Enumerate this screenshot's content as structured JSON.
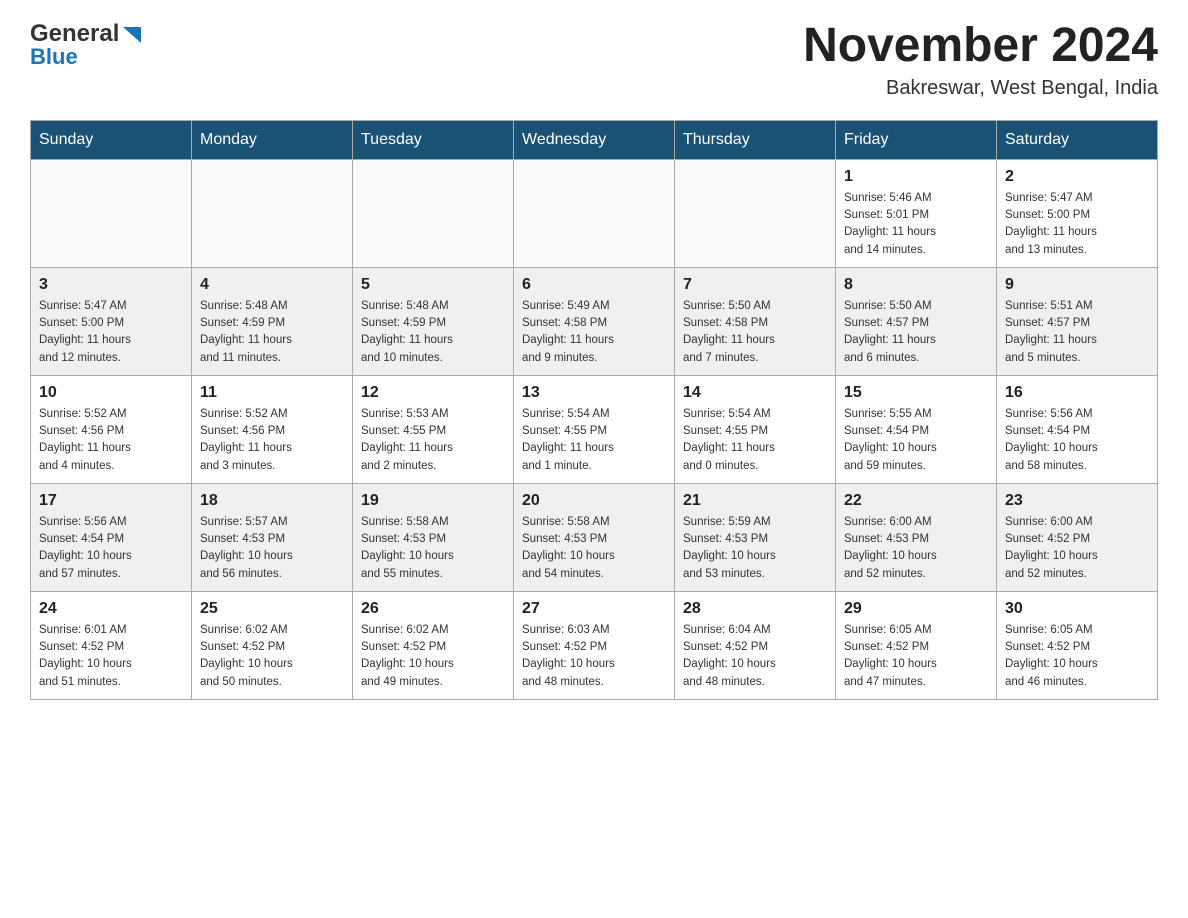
{
  "header": {
    "logo_general": "General",
    "logo_blue": "Blue",
    "month_title": "November 2024",
    "location": "Bakreswar, West Bengal, India"
  },
  "days_of_week": [
    "Sunday",
    "Monday",
    "Tuesday",
    "Wednesday",
    "Thursday",
    "Friday",
    "Saturday"
  ],
  "weeks": [
    {
      "days": [
        {
          "number": "",
          "info": ""
        },
        {
          "number": "",
          "info": ""
        },
        {
          "number": "",
          "info": ""
        },
        {
          "number": "",
          "info": ""
        },
        {
          "number": "",
          "info": ""
        },
        {
          "number": "1",
          "info": "Sunrise: 5:46 AM\nSunset: 5:01 PM\nDaylight: 11 hours\nand 14 minutes."
        },
        {
          "number": "2",
          "info": "Sunrise: 5:47 AM\nSunset: 5:00 PM\nDaylight: 11 hours\nand 13 minutes."
        }
      ]
    },
    {
      "days": [
        {
          "number": "3",
          "info": "Sunrise: 5:47 AM\nSunset: 5:00 PM\nDaylight: 11 hours\nand 12 minutes."
        },
        {
          "number": "4",
          "info": "Sunrise: 5:48 AM\nSunset: 4:59 PM\nDaylight: 11 hours\nand 11 minutes."
        },
        {
          "number": "5",
          "info": "Sunrise: 5:48 AM\nSunset: 4:59 PM\nDaylight: 11 hours\nand 10 minutes."
        },
        {
          "number": "6",
          "info": "Sunrise: 5:49 AM\nSunset: 4:58 PM\nDaylight: 11 hours\nand 9 minutes."
        },
        {
          "number": "7",
          "info": "Sunrise: 5:50 AM\nSunset: 4:58 PM\nDaylight: 11 hours\nand 7 minutes."
        },
        {
          "number": "8",
          "info": "Sunrise: 5:50 AM\nSunset: 4:57 PM\nDaylight: 11 hours\nand 6 minutes."
        },
        {
          "number": "9",
          "info": "Sunrise: 5:51 AM\nSunset: 4:57 PM\nDaylight: 11 hours\nand 5 minutes."
        }
      ]
    },
    {
      "days": [
        {
          "number": "10",
          "info": "Sunrise: 5:52 AM\nSunset: 4:56 PM\nDaylight: 11 hours\nand 4 minutes."
        },
        {
          "number": "11",
          "info": "Sunrise: 5:52 AM\nSunset: 4:56 PM\nDaylight: 11 hours\nand 3 minutes."
        },
        {
          "number": "12",
          "info": "Sunrise: 5:53 AM\nSunset: 4:55 PM\nDaylight: 11 hours\nand 2 minutes."
        },
        {
          "number": "13",
          "info": "Sunrise: 5:54 AM\nSunset: 4:55 PM\nDaylight: 11 hours\nand 1 minute."
        },
        {
          "number": "14",
          "info": "Sunrise: 5:54 AM\nSunset: 4:55 PM\nDaylight: 11 hours\nand 0 minutes."
        },
        {
          "number": "15",
          "info": "Sunrise: 5:55 AM\nSunset: 4:54 PM\nDaylight: 10 hours\nand 59 minutes."
        },
        {
          "number": "16",
          "info": "Sunrise: 5:56 AM\nSunset: 4:54 PM\nDaylight: 10 hours\nand 58 minutes."
        }
      ]
    },
    {
      "days": [
        {
          "number": "17",
          "info": "Sunrise: 5:56 AM\nSunset: 4:54 PM\nDaylight: 10 hours\nand 57 minutes."
        },
        {
          "number": "18",
          "info": "Sunrise: 5:57 AM\nSunset: 4:53 PM\nDaylight: 10 hours\nand 56 minutes."
        },
        {
          "number": "19",
          "info": "Sunrise: 5:58 AM\nSunset: 4:53 PM\nDaylight: 10 hours\nand 55 minutes."
        },
        {
          "number": "20",
          "info": "Sunrise: 5:58 AM\nSunset: 4:53 PM\nDaylight: 10 hours\nand 54 minutes."
        },
        {
          "number": "21",
          "info": "Sunrise: 5:59 AM\nSunset: 4:53 PM\nDaylight: 10 hours\nand 53 minutes."
        },
        {
          "number": "22",
          "info": "Sunrise: 6:00 AM\nSunset: 4:53 PM\nDaylight: 10 hours\nand 52 minutes."
        },
        {
          "number": "23",
          "info": "Sunrise: 6:00 AM\nSunset: 4:52 PM\nDaylight: 10 hours\nand 52 minutes."
        }
      ]
    },
    {
      "days": [
        {
          "number": "24",
          "info": "Sunrise: 6:01 AM\nSunset: 4:52 PM\nDaylight: 10 hours\nand 51 minutes."
        },
        {
          "number": "25",
          "info": "Sunrise: 6:02 AM\nSunset: 4:52 PM\nDaylight: 10 hours\nand 50 minutes."
        },
        {
          "number": "26",
          "info": "Sunrise: 6:02 AM\nSunset: 4:52 PM\nDaylight: 10 hours\nand 49 minutes."
        },
        {
          "number": "27",
          "info": "Sunrise: 6:03 AM\nSunset: 4:52 PM\nDaylight: 10 hours\nand 48 minutes."
        },
        {
          "number": "28",
          "info": "Sunrise: 6:04 AM\nSunset: 4:52 PM\nDaylight: 10 hours\nand 48 minutes."
        },
        {
          "number": "29",
          "info": "Sunrise: 6:05 AM\nSunset: 4:52 PM\nDaylight: 10 hours\nand 47 minutes."
        },
        {
          "number": "30",
          "info": "Sunrise: 6:05 AM\nSunset: 4:52 PM\nDaylight: 10 hours\nand 46 minutes."
        }
      ]
    }
  ]
}
